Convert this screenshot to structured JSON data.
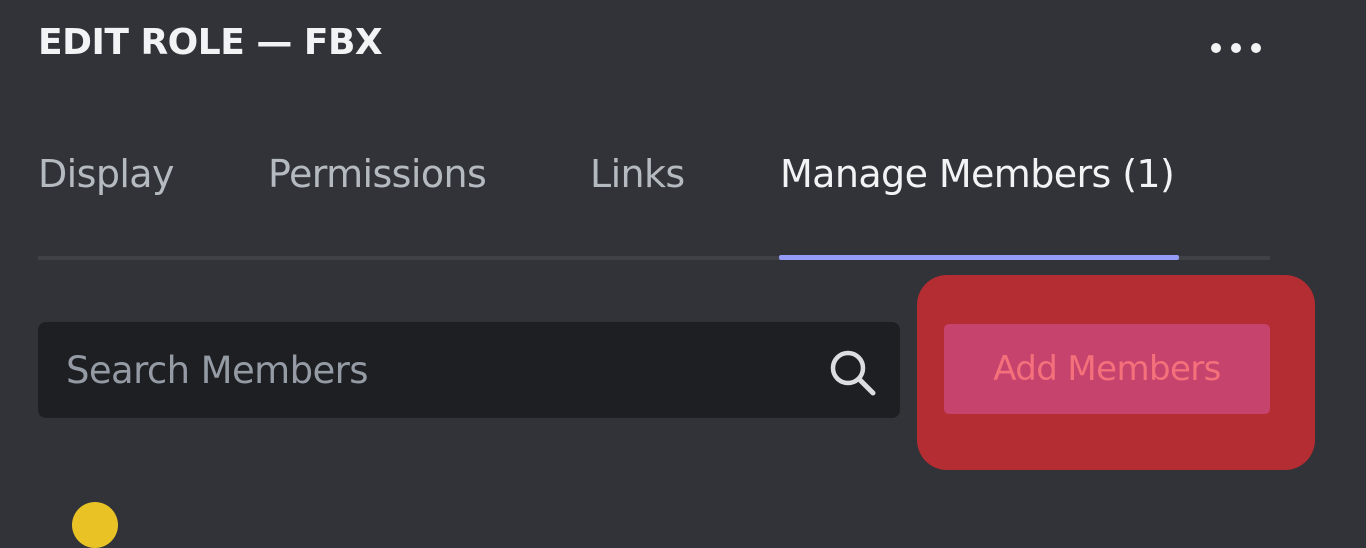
{
  "header": {
    "title": "EDIT ROLE — FBX",
    "more_icon": "more-horizontal-icon"
  },
  "tabs": [
    {
      "label": "Display",
      "active": false
    },
    {
      "label": "Permissions",
      "active": false
    },
    {
      "label": "Links",
      "active": false
    },
    {
      "label": "Manage Members (1)",
      "active": true
    }
  ],
  "members": {
    "search": {
      "placeholder": "Search Members",
      "value": "",
      "icon": "search-icon"
    },
    "add_button_label": "Add Members",
    "avatar_icon": "member-avatar"
  },
  "colors": {
    "background": "#313338",
    "tab_indicator": "#949cf7",
    "add_button": "#c6436d",
    "highlight": "#b32d33"
  }
}
